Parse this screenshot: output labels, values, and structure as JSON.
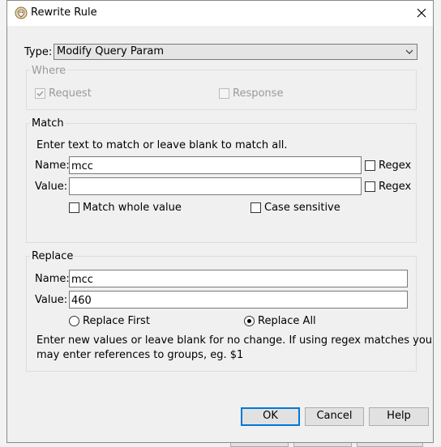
{
  "window": {
    "title": "Rewrite Rule"
  },
  "type": {
    "label": "Type:",
    "value": "Modify Query Param"
  },
  "where": {
    "title": "Where",
    "request": {
      "label": "Request",
      "checked": true,
      "enabled": false
    },
    "response": {
      "label": "Response",
      "checked": false,
      "enabled": false
    }
  },
  "match": {
    "title": "Match",
    "instruction": "Enter text to match or leave blank to match all.",
    "name_label": "Name:",
    "name_value": "mcc",
    "value_label": "Value:",
    "value_value": "",
    "regex_label": "Regex",
    "value_regex_label": "Regex",
    "match_whole_label": "Match whole value",
    "case_sensitive_label": "Case sensitive"
  },
  "replace": {
    "title": "Replace",
    "name_label": "Name:",
    "name_value": "mcc",
    "value_label": "Value:",
    "value_value": "460",
    "replace_first_label": "Replace First",
    "replace_all_label": "Replace All",
    "selected": "Replace All",
    "note_line1": "Enter new values or leave blank for no change. If using regex matches you",
    "note_line2": "may enter references to groups, eg. $1"
  },
  "buttons": {
    "ok": "OK",
    "cancel": "Cancel",
    "help": "Help"
  }
}
